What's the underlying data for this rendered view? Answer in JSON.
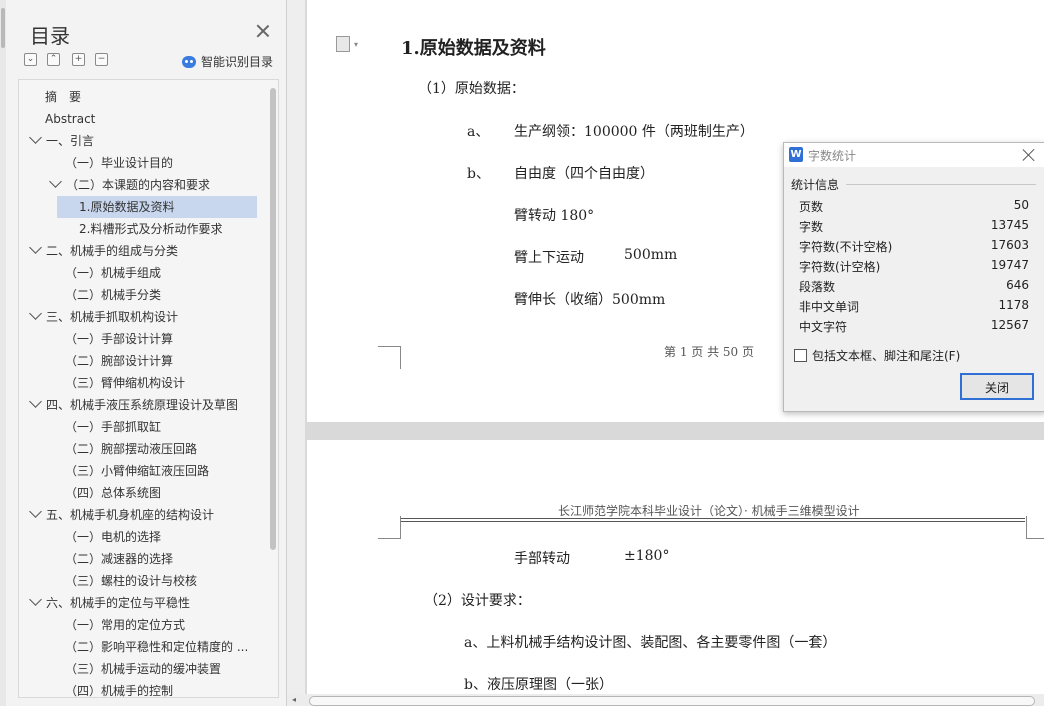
{
  "toc": {
    "title": "目录",
    "smart_label": "智能识别目录",
    "tool_icons": [
      "collapse-all-icon",
      "expand-level-icon",
      "add-icon",
      "remove-icon"
    ],
    "items": [
      {
        "label": "摘　要",
        "level": 0,
        "chev": false
      },
      {
        "label": "Abstract",
        "level": 0,
        "chev": false
      },
      {
        "label": "一、引言",
        "level": 0,
        "chev": true
      },
      {
        "label": "（一）毕业设计目的",
        "level": 1,
        "chev": false
      },
      {
        "label": "（二）本课题的内容和要求",
        "level": 1,
        "chev": true
      },
      {
        "label": "1.原始数据及资料",
        "level": 2,
        "chev": false,
        "selected": true
      },
      {
        "label": "2.料槽形式及分析动作要求",
        "level": 2,
        "chev": false
      },
      {
        "label": "二、机械手的组成与分类",
        "level": 0,
        "chev": true
      },
      {
        "label": "（一）机械手组成",
        "level": 1,
        "chev": false
      },
      {
        "label": "（二）机械手分类",
        "level": 1,
        "chev": false
      },
      {
        "label": "三、机械手抓取机构设计",
        "level": 0,
        "chev": true
      },
      {
        "label": "（一）手部设计计算",
        "level": 1,
        "chev": false
      },
      {
        "label": "（二）腕部设计计算",
        "level": 1,
        "chev": false
      },
      {
        "label": "（三）臂伸缩机构设计",
        "level": 1,
        "chev": false
      },
      {
        "label": "四、机械手液压系统原理设计及草图",
        "level": 0,
        "chev": true
      },
      {
        "label": "（一）手部抓取缸",
        "level": 1,
        "chev": false
      },
      {
        "label": "（二）腕部摆动液压回路",
        "level": 1,
        "chev": false
      },
      {
        "label": "（三）小臂伸缩缸液压回路",
        "level": 1,
        "chev": false
      },
      {
        "label": "（四）总体系统图",
        "level": 1,
        "chev": false
      },
      {
        "label": "五、机械手机身机座的结构设计",
        "level": 0,
        "chev": true
      },
      {
        "label": "（一）电机的选择",
        "level": 1,
        "chev": false
      },
      {
        "label": "（二）减速器的选择",
        "level": 1,
        "chev": false
      },
      {
        "label": "（三）螺柱的设计与校核",
        "level": 1,
        "chev": false
      },
      {
        "label": "六、机械手的定位与平稳性",
        "level": 0,
        "chev": true
      },
      {
        "label": "（一）常用的定位方式",
        "level": 1,
        "chev": false
      },
      {
        "label": "（二）影响平稳性和定位精度的 ...",
        "level": 1,
        "chev": false
      },
      {
        "label": "（三）机械手运动的缓冲装置",
        "level": 1,
        "chev": false
      },
      {
        "label": "（四）机械手的控制",
        "level": 1,
        "chev": false
      }
    ]
  },
  "doc": {
    "heading": "1.原始数据及资料",
    "p1_label": "（1）原始数据：",
    "a_marker": "a、",
    "a_text": "生产纲领：100000 件（两班制生产）",
    "b_marker": "b、",
    "b_text": "自由度（四个自由度）",
    "arm_rotate": "臂转动 180°",
    "arm_updown": "臂上下运动",
    "arm_updown_val": "500mm",
    "arm_extend": "臂伸长（收缩）500mm",
    "page_footer": "第 1 页 共 50 页",
    "page2_header": "长江师范学院本科毕业设计（论文）· 机械手三维模型设计",
    "hand_rotate": "手部转动",
    "hand_rotate_val": "±180°",
    "p2_label": "（2）设计要求：",
    "req_a": "a、上料机械手结构设计图、装配图、各主要零件图（一套）",
    "req_b": "b、液压原理图（一张）"
  },
  "dialog": {
    "title": "字数统计",
    "section": "统计信息",
    "stats": [
      {
        "label": "页数",
        "value": "50"
      },
      {
        "label": "字数",
        "value": "13745"
      },
      {
        "label": "字符数(不计空格)",
        "value": "17603"
      },
      {
        "label": "字符数(计空格)",
        "value": "19747"
      },
      {
        "label": "段落数",
        "value": "646"
      },
      {
        "label": "非中文单词",
        "value": "1178"
      },
      {
        "label": "中文字符",
        "value": "12567"
      }
    ],
    "checkbox_label": "包括文本框、脚注和尾注(F)",
    "checkbox_checked": false,
    "close_label": "关闭"
  }
}
